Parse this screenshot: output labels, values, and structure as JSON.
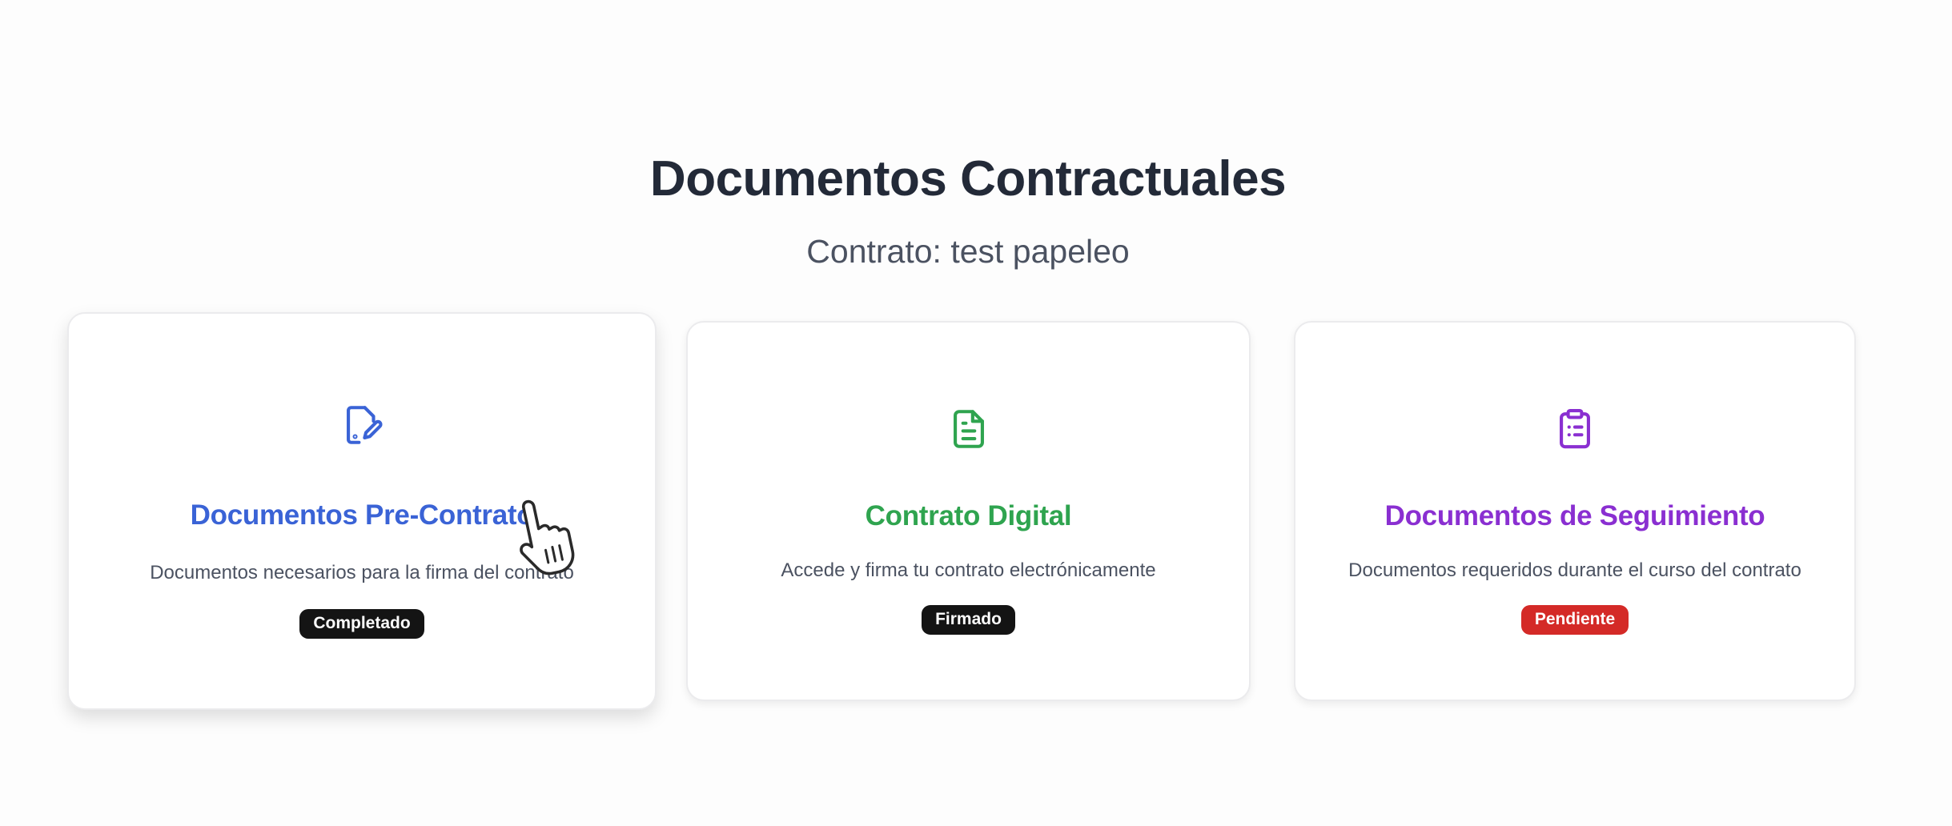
{
  "header": {
    "title": "Documentos Contractuales",
    "subtitle": "Contrato: test papeleo"
  },
  "colors": {
    "blue": "#3a63d6",
    "green": "#2fa44f",
    "purple": "#8a2fd1",
    "badge_dark": "#141414",
    "badge_red": "#d42a27"
  },
  "cards": [
    {
      "icon": "document-edit-icon",
      "title": "Documentos Pre-Contrato",
      "description": "Documentos necesarios para la firma del contrato",
      "status": "Completado"
    },
    {
      "icon": "document-text-icon",
      "title": "Contrato Digital",
      "description": "Accede y firma tu contrato electrónicamente",
      "status": "Firmado"
    },
    {
      "icon": "clipboard-list-icon",
      "title": "Documentos de Seguimiento",
      "description": "Documentos requeridos durante el curso del contrato",
      "status": "Pendiente"
    }
  ],
  "cursor": "hand-pointer-icon"
}
